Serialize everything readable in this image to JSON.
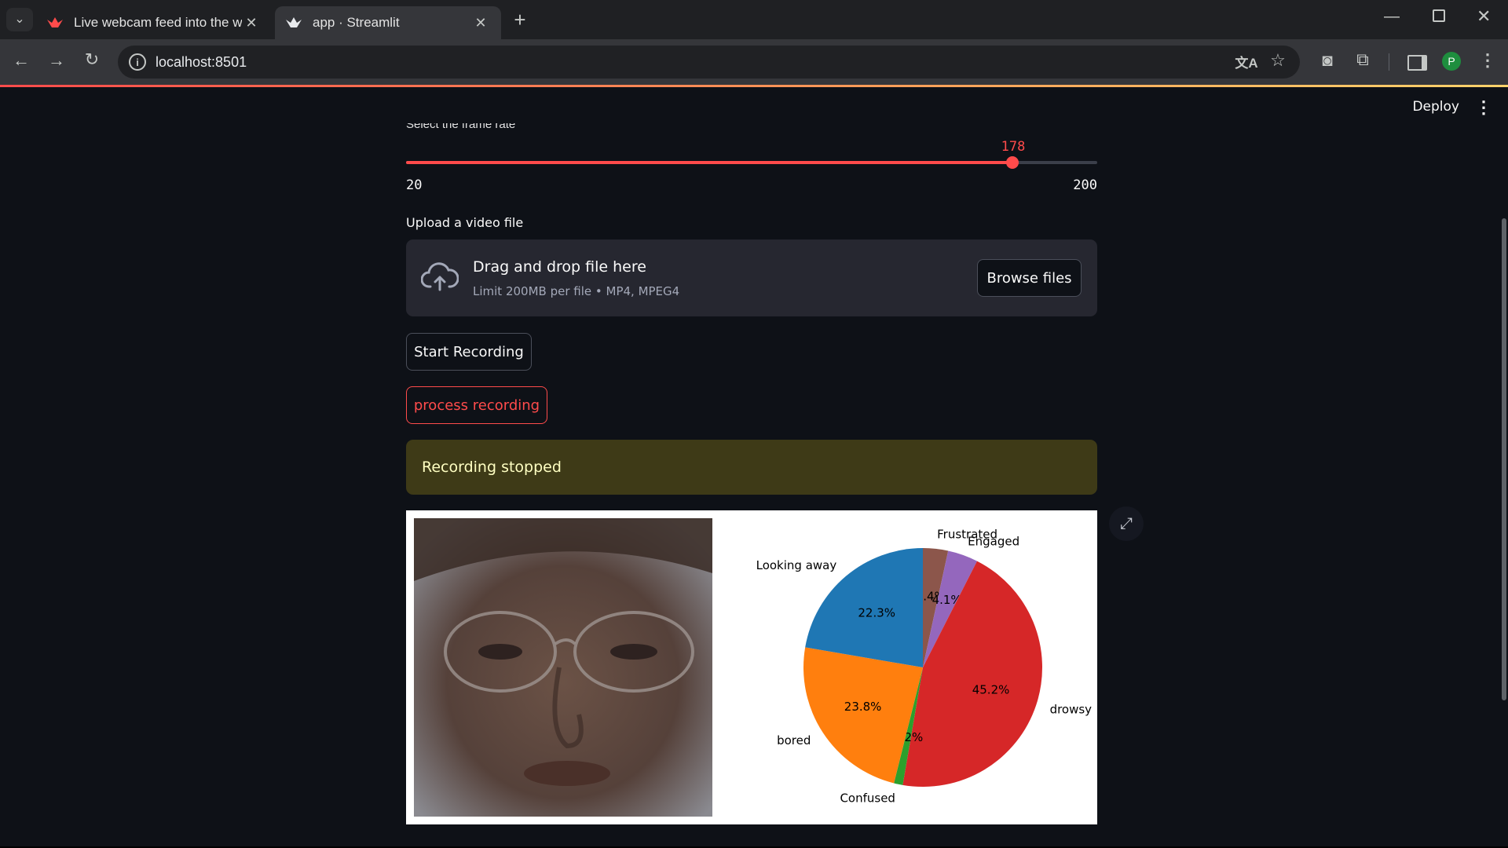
{
  "browser": {
    "tabs": [
      {
        "title": "Live webcam feed into the web",
        "active": false
      },
      {
        "title": "app · Streamlit",
        "active": true
      }
    ],
    "url": "localhost:8501",
    "profile_initial": "P",
    "icons": {
      "tab_search": "chevron-down-icon",
      "new_tab": "plus-icon",
      "back": "arrow-left-icon",
      "forward": "arrow-right-icon",
      "reload": "reload-icon",
      "site_info": "info-icon",
      "translate": "translate-icon",
      "bookmark": "star-icon",
      "screenshot": "camera-icon",
      "extensions": "puzzle-icon",
      "side_panel": "side-panel-icon",
      "menu": "kebab-icon"
    }
  },
  "header": {
    "deploy_label": "Deploy"
  },
  "slider": {
    "label": "Select the frame rate",
    "value": "178",
    "min": "20",
    "max": "200",
    "accent": "#ff4b4b"
  },
  "uploader": {
    "label": "Upload a video file",
    "title": "Drag and drop file here",
    "subtitle": "Limit 200MB per file • MP4, MPEG4",
    "browse_label": "Browse files"
  },
  "buttons": {
    "start_label": "Start Recording",
    "process_label": "process recording"
  },
  "alert": {
    "text": "Recording stopped",
    "color": "#3e3a17"
  },
  "chart_data": {
    "type": "pie",
    "categories": [
      "Frustrated",
      "Engaged",
      "drowsy",
      "Confused",
      "bored",
      "Looking away"
    ],
    "values": [
      3.4,
      4.1,
      45.2,
      1.2,
      23.8,
      22.3
    ],
    "labels_pct": [
      "3.4%",
      "4.1%",
      "45.2%",
      "1.2%",
      "23.8%",
      "22.3%"
    ],
    "colors": [
      "#8c564b",
      "#9467bd",
      "#d62728",
      "#2ca02c",
      "#ff7f0e",
      "#1f77b4"
    ],
    "start_angle": 90,
    "direction": "clockwise"
  }
}
